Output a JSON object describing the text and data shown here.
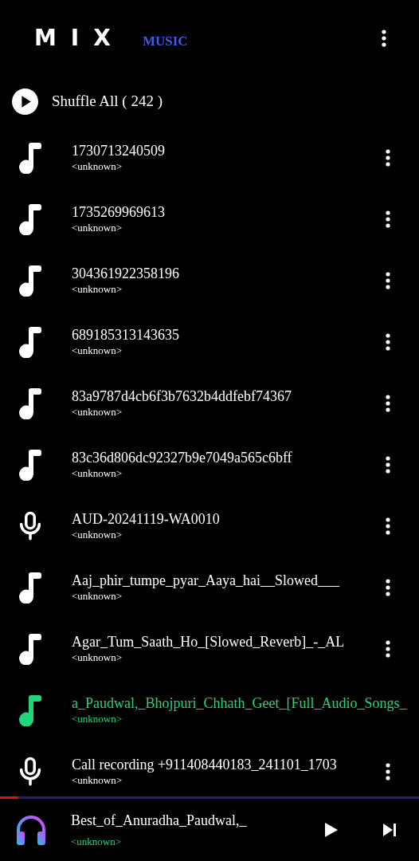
{
  "header": {
    "logo_main": "MIX",
    "logo_sub": "MUSIC"
  },
  "shuffle": {
    "label": "Shuffle All ( 242 )"
  },
  "songs": [
    {
      "kind": "song",
      "title": "1730713240509",
      "artist": "<unknown>",
      "playing": false
    },
    {
      "kind": "song",
      "title": "1735269969613",
      "artist": "<unknown>",
      "playing": false
    },
    {
      "kind": "song",
      "title": "304361922358196",
      "artist": "<unknown>",
      "playing": false
    },
    {
      "kind": "song",
      "title": "689185313143635",
      "artist": "<unknown>",
      "playing": false
    },
    {
      "kind": "song",
      "title": "83a9787d4cb6f3b7632b4ddfebf74367",
      "artist": "<unknown>",
      "playing": false
    },
    {
      "kind": "song",
      "title": "83c36d806dc92327b9e7049a565c6bff",
      "artist": "<unknown>",
      "playing": false
    },
    {
      "kind": "recording",
      "title": "AUD-20241119-WA0010",
      "artist": "<unknown>",
      "playing": false
    },
    {
      "kind": "song",
      "title": "Aaj_phir_tumpe_pyar_Aaya_hai__Slowed___",
      "artist": "<unknown>",
      "playing": false
    },
    {
      "kind": "song",
      "title": "Agar_Tum_Saath_Ho_[Slowed_Reverb]_-_AL",
      "artist": "<unknown>",
      "playing": false
    },
    {
      "kind": "song",
      "title": "a_Paudwal,_Bhojpuri_Chhath_Geet_[Full_Audio_Songs_",
      "artist": "<unknown>",
      "playing": true
    },
    {
      "kind": "recording",
      "title": "Call recording +911408440183_241101_1703",
      "artist": "<unknown>",
      "playing": false
    }
  ],
  "player": {
    "title": "Best_of_Anuradha_Paudwal,_",
    "artist": "<unknown>",
    "level": 0.044
  }
}
